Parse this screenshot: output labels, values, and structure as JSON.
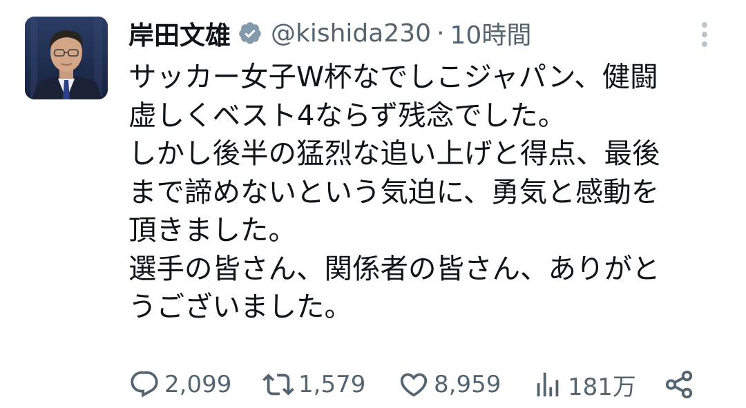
{
  "user": {
    "display_name": "岸田文雄",
    "handle": "@kishida230",
    "separator": "·",
    "time": "10時間",
    "verified": true,
    "verified_color": "#829aab"
  },
  "tweet": {
    "lines": [
      "サッカー女子W杯なでしこジャパン、健闘",
      "虚しくベスト4ならず残念でした。",
      "しかし後半の猛烈な追い上げと得点、最後",
      "まで諦めないという気迫に、勇気と感動を",
      "頂きました。",
      "選手の皆さん、関係者の皆さん、ありがと",
      "うございました。"
    ]
  },
  "actions": {
    "reply": {
      "icon": "reply-icon",
      "count": "2,099"
    },
    "retweet": {
      "icon": "retweet-icon",
      "count": "1,579"
    },
    "like": {
      "icon": "heart-icon",
      "count": "8,959"
    },
    "views": {
      "icon": "views-icon",
      "count": "181万"
    },
    "share": {
      "icon": "share-icon"
    }
  },
  "colors": {
    "text": "#0f1419",
    "secondary": "#536471",
    "background": "#ffffff"
  }
}
